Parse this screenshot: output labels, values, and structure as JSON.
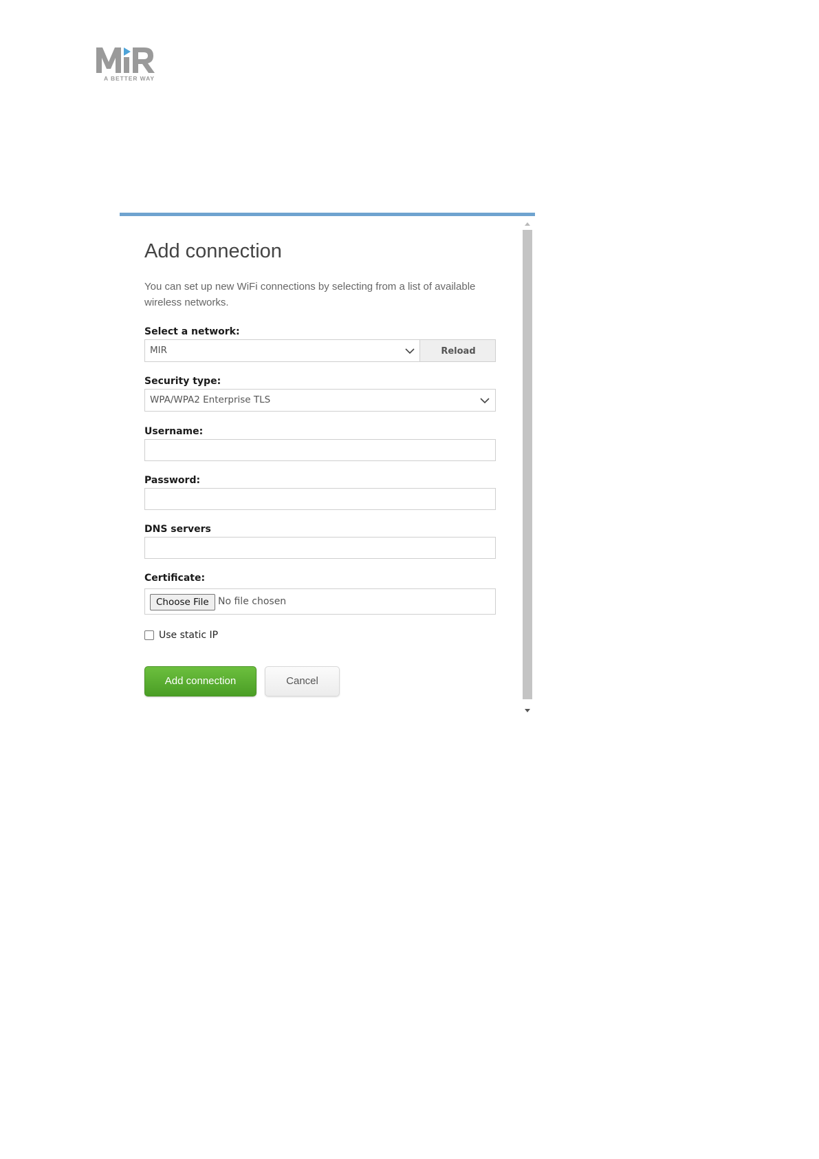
{
  "logo": {
    "brand": "MiR",
    "tagline": "A BETTER WAY"
  },
  "dialog": {
    "title": "Add connection",
    "description": "You can set up new WiFi connections by selecting from a list of available wireless networks.",
    "network": {
      "label": "Select a network:",
      "selected": "MIR",
      "reload_label": "Reload"
    },
    "security": {
      "label": "Security type:",
      "selected": "WPA/WPA2 Enterprise TLS"
    },
    "username": {
      "label": "Username:",
      "value": ""
    },
    "password": {
      "label": "Password:",
      "value": ""
    },
    "dns": {
      "label": "DNS servers",
      "value": ""
    },
    "certificate": {
      "label": "Certificate:",
      "button_label": "Choose File",
      "status": "No file chosen"
    },
    "static_ip": {
      "label": "Use static IP",
      "checked": false
    },
    "actions": {
      "add_label": "Add connection",
      "cancel_label": "Cancel"
    }
  },
  "colors": {
    "accent_bar": "#6fa3cf",
    "primary_button": "#5aae30",
    "logo_gray": "#9a9a9a",
    "logo_blue": "#4da3d8"
  }
}
